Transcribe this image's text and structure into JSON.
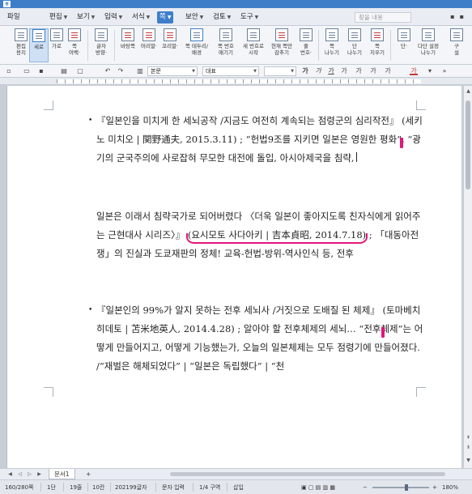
{
  "app": {
    "logo": "ㅎ"
  },
  "menu": {
    "items": [
      {
        "label": "파일",
        "dropdown": false
      },
      {
        "label": "편집",
        "dropdown": true
      },
      {
        "label": "보기",
        "dropdown": true
      },
      {
        "label": "입력",
        "dropdown": true
      },
      {
        "label": "서식",
        "dropdown": true
      },
      {
        "label": "쪽",
        "dropdown": true
      },
      {
        "label": "보안",
        "dropdown": true
      },
      {
        "label": "검토",
        "dropdown": true
      },
      {
        "label": "도구",
        "dropdown": true
      }
    ],
    "search_placeholder": "찾을 내용"
  },
  "ribbon": {
    "buttons": [
      {
        "label": "편집\n용지",
        "icon": "page-setup-icon"
      },
      {
        "label": "세로",
        "icon": "portrait-icon",
        "active": true
      },
      {
        "label": "가로",
        "icon": "landscape-icon"
      },
      {
        "label": "쪽\n여백·",
        "icon": "margin-icon"
      },
      {
        "label": "글자\n방향·",
        "icon": "text-direction-icon"
      },
      {
        "label": "바탕쪽",
        "icon": "master-page-icon"
      },
      {
        "label": "머리말·",
        "icon": "header-icon"
      },
      {
        "label": "꼬리말·",
        "icon": "footer-icon"
      },
      {
        "label": "쪽 테두리/\n배경",
        "icon": "page-border-icon"
      },
      {
        "label": "쪽 번호\n매기기",
        "icon": "page-number-icon"
      },
      {
        "label": "새 번호로\n시작",
        "icon": "new-number-icon"
      },
      {
        "label": "현재 쪽만\n감추기",
        "icon": "hide-page-icon"
      },
      {
        "label": "줄\n번호·",
        "icon": "line-number-icon"
      },
      {
        "label": "쪽\n나누기",
        "icon": "page-break-icon"
      },
      {
        "label": "단\n나누기",
        "icon": "column-break-icon"
      },
      {
        "label": "쪽\n지우기",
        "icon": "delete-page-icon"
      },
      {
        "label": "단·",
        "icon": "columns-icon"
      },
      {
        "label": "다단 설정\n나누기",
        "icon": "multi-column-icon"
      },
      {
        "label": "구\n설",
        "icon": "section-icon"
      }
    ]
  },
  "format_bar": {
    "style": "본문",
    "font": "대표"
  },
  "document": {
    "paragraphs": [
      {
        "bullet": "•",
        "text_a": "『일본인을 미치게 한 세뇌공작 /지금도 여전히 계속되는 점령군의 심리작전』",
        "highlight": "(세키노 미치오 | 関野通夫, 2015.3.11)",
        "text_b": "; “헌법9조를 지키면 일본은 영원한 평화”, “광기의 군국주의에 사로잡혀 무모한 대전에 돌입, 아시아제국을 침략,"
      },
      {
        "bullet": "",
        "text_a": "일본은 이래서 침략국가로 되어버렸다 〈더욱 일본이 좋아지도록 친자식에게 읽어주는 근현대사 시리즈〉』",
        "highlight": "(요시모토 사다아키 | 吉本貞昭, 2014.7.18)",
        "text_b": "; 「대동아전쟁」의 진실과 도쿄재판의 정체! 교육-헌법-방위-역사인식 등, 전후"
      },
      {
        "bullet": "•",
        "text_a": "『일본인의 99%가 알지 못하는 전후 세뇌사 /거짓으로 도배질 된 체제』",
        "highlight": "(토마베치 히데토 | 苫米地英人, 2014.4.28)",
        "text_b": "; 알아야 할 전후체제의 세뇌… “전후체제”는 어떻게 만들어지고, 어떻게 기능했는가, 오늘의 일본체제는 모두 점령기에 만들어졌다. /“재벌은 해체되었다” | “일본은 독립했다” | “천"
      }
    ]
  },
  "tabs": {
    "items": [
      "문서1"
    ],
    "add_label": "+"
  },
  "status": {
    "page": "160/280쪽",
    "section": "1단",
    "line": "19줄",
    "column": "10칸",
    "chars": "202199글자",
    "mode": "문자 입력",
    "zone": "1/4 구역",
    "insert": "삽입",
    "zoom": "180%",
    "zoom_level": 0.6
  }
}
